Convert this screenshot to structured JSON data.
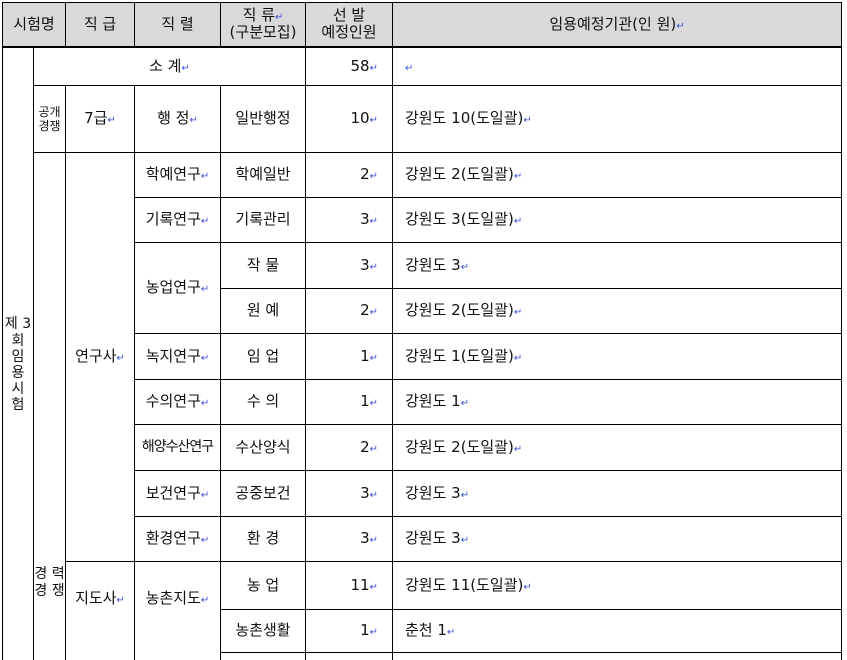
{
  "headers": {
    "exam": "시험명",
    "grade": "직 급",
    "series": "직 렬",
    "class": "직 류",
    "class_sub": "(구분모집)",
    "count": "선 발",
    "count_sub": "예정인원",
    "agency": "임용예정기관(인 원)"
  },
  "exam_name": "제 3 회 임 용 시 험",
  "subtotal": {
    "label": "소 계",
    "count": "58"
  },
  "open": {
    "label": "공개경쟁",
    "grade": "7급",
    "series": "행 정",
    "class": "일반행정",
    "count": "10",
    "agency": "강원도 10(도일괄)"
  },
  "career": {
    "label": "경 력 경 쟁",
    "grade_researcher": "연구사",
    "grade_instructor": "지도사",
    "rows": [
      {
        "series": "학예연구",
        "class": "학예일반",
        "count": "2",
        "agency": "강원도 2(도일괄)"
      },
      {
        "series": "기록연구",
        "class": "기록관리",
        "count": "3",
        "agency": "강원도 3(도일괄)"
      },
      {
        "series": "농업연구",
        "class": "작 물",
        "count": "3",
        "agency": "강원도 3"
      },
      {
        "series": "",
        "class": "원 예",
        "count": "2",
        "agency": "강원도 2(도일괄)"
      },
      {
        "series": "녹지연구",
        "class": "임 업",
        "count": "1",
        "agency": "강원도 1(도일괄)"
      },
      {
        "series": "수의연구",
        "class": "수 의",
        "count": "1",
        "agency": "강원도 1"
      },
      {
        "series": "해양수산연구",
        "class": "수산양식",
        "count": "2",
        "agency": "강원도 2(도일괄)"
      },
      {
        "series": "보건연구",
        "class": "공중보건",
        "count": "3",
        "agency": "강원도 3"
      },
      {
        "series": "환경연구",
        "class": "환 경",
        "count": "3",
        "agency": "강원도 3"
      },
      {
        "series": "농촌지도",
        "class": "농 업",
        "count": "11",
        "agency": "강원도 11(도일괄)"
      },
      {
        "series": "",
        "class": "농촌생활",
        "count": "1",
        "agency": "춘천 1"
      },
      {
        "series": "",
        "class": "",
        "count": "",
        "agency": ""
      }
    ]
  },
  "colors": {
    "header_bg": "#d9d9d9",
    "border": "#000000",
    "edit_mark": "#3a4fd8"
  }
}
